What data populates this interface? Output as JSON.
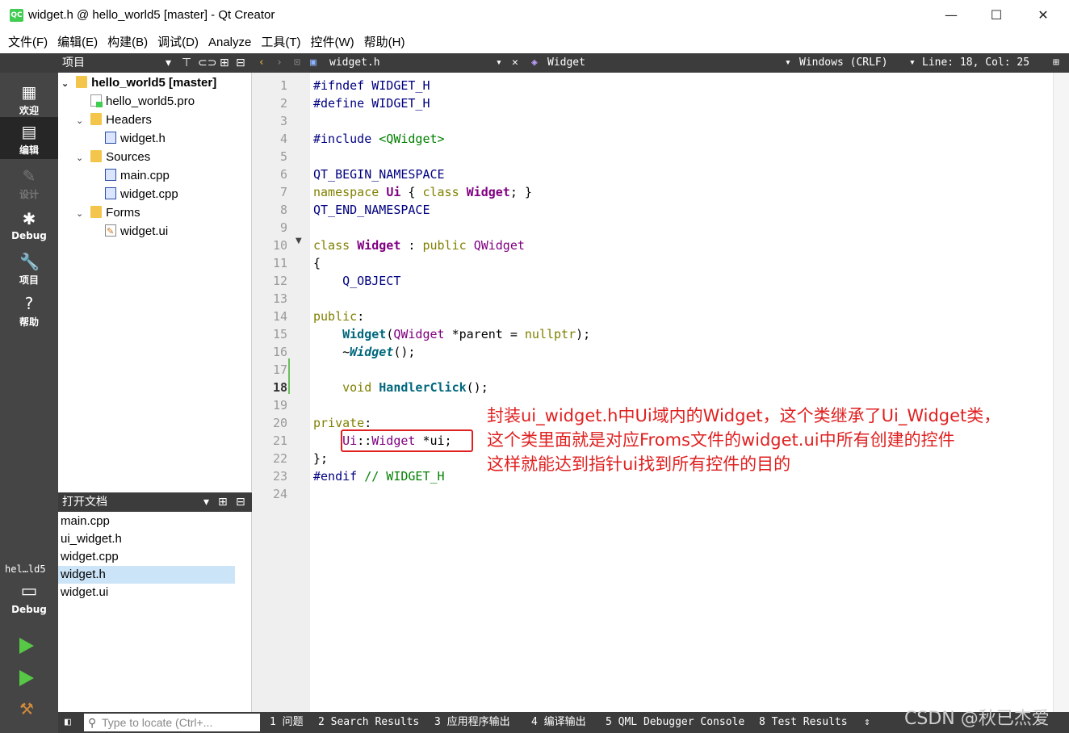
{
  "window": {
    "title": "widget.h @ hello_world5 [master] - Qt Creator",
    "app_icon_text": "QC",
    "controls": [
      "—",
      "☐",
      "✕"
    ]
  },
  "menu": [
    "文件(F)",
    "编辑(E)",
    "构建(B)",
    "调试(D)",
    "Analyze",
    "工具(T)",
    "控件(W)",
    "帮助(H)"
  ],
  "modes": [
    {
      "label": "欢迎",
      "icon": "grid-icon"
    },
    {
      "label": "编辑",
      "icon": "document-icon"
    },
    {
      "label": "设计",
      "icon": "pencil-icon"
    },
    {
      "label": "Debug",
      "icon": "bug-icon"
    },
    {
      "label": "项目",
      "icon": "wrench-icon"
    },
    {
      "label": "帮助",
      "icon": "help-icon"
    }
  ],
  "target": {
    "name": "hel…ld5",
    "label": "Debug"
  },
  "project_pane": {
    "title": "项目",
    "tree": [
      {
        "label": "hello_world5 [master]",
        "bold": true
      },
      {
        "label": "hello_world5.pro"
      },
      {
        "label": "Headers"
      },
      {
        "label": "widget.h"
      },
      {
        "label": "Sources"
      },
      {
        "label": "main.cpp"
      },
      {
        "label": "widget.cpp"
      },
      {
        "label": "Forms"
      },
      {
        "label": "widget.ui"
      }
    ]
  },
  "open_docs": {
    "title": "打开文档",
    "items": [
      "main.cpp",
      "ui_widget.h",
      "widget.cpp",
      "widget.h",
      "widget.ui"
    ],
    "selected": "widget.h"
  },
  "editor_toolbar": {
    "file": "widget.h",
    "symbol": "Widget",
    "line_ending": "Windows (CRLF)",
    "cursor": "Line: 18, Col: 25"
  },
  "editor": {
    "line_numbers": [
      "1",
      "2",
      "3",
      "4",
      "5",
      "6",
      "7",
      "8",
      "9",
      "10",
      "11",
      "12",
      "13",
      "14",
      "15",
      "16",
      "17",
      "18",
      "19",
      "20",
      "21",
      "22",
      "23",
      "24"
    ],
    "current_line": "18",
    "fold_marker_line": "10",
    "lines": [
      [
        {
          "t": "#ifndef WIDGET_H",
          "c": "mac"
        }
      ],
      [
        {
          "t": "#define WIDGET_H",
          "c": "mac"
        }
      ],
      [],
      [
        {
          "t": "#include ",
          "c": "mac"
        },
        {
          "t": "<QWidget>",
          "c": "str"
        }
      ],
      [],
      [
        {
          "t": "QT_BEGIN_NAMESPACE",
          "c": "mac"
        }
      ],
      [
        {
          "t": "namespace ",
          "c": "kw"
        },
        {
          "t": "Ui",
          "c": "cls"
        },
        {
          "t": " { ",
          "c": ""
        },
        {
          "t": "class ",
          "c": "kw"
        },
        {
          "t": "Widget",
          "c": "cls"
        },
        {
          "t": "; }",
          "c": ""
        }
      ],
      [
        {
          "t": "QT_END_NAMESPACE",
          "c": "mac"
        }
      ],
      [],
      [
        {
          "t": "class ",
          "c": "kw"
        },
        {
          "t": "Widget",
          "c": "cls"
        },
        {
          "t": " : ",
          "c": ""
        },
        {
          "t": "public ",
          "c": "kw"
        },
        {
          "t": "QWidget",
          "c": "typ"
        }
      ],
      [
        {
          "t": "{",
          "c": ""
        }
      ],
      [
        {
          "t": "    Q_OBJECT",
          "c": "mac"
        }
      ],
      [],
      [
        {
          "t": "public",
          "c": "kw"
        },
        {
          "t": ":",
          "c": ""
        }
      ],
      [
        {
          "t": "    ",
          "c": ""
        },
        {
          "t": "Widget",
          "c": "fn"
        },
        {
          "t": "(",
          "c": ""
        },
        {
          "t": "QWidget",
          "c": "typ"
        },
        {
          "t": " *parent = ",
          "c": ""
        },
        {
          "t": "nullptr",
          "c": "kw"
        },
        {
          "t": ");",
          "c": ""
        }
      ],
      [
        {
          "t": "    ~",
          "c": ""
        },
        {
          "t": "Widget",
          "c": "fni"
        },
        {
          "t": "();",
          "c": ""
        }
      ],
      [],
      [
        {
          "t": "    ",
          "c": ""
        },
        {
          "t": "void ",
          "c": "kw"
        },
        {
          "t": "HandlerClick",
          "c": "fn"
        },
        {
          "t": "();",
          "c": ""
        }
      ],
      [],
      [
        {
          "t": "private",
          "c": "kw"
        },
        {
          "t": ":",
          "c": ""
        }
      ],
      [
        {
          "t": "    ",
          "c": ""
        },
        {
          "t": "Ui",
          "c": "typ"
        },
        {
          "t": "::",
          "c": ""
        },
        {
          "t": "Widget",
          "c": "typ"
        },
        {
          "t": " *ui;",
          "c": ""
        }
      ],
      [
        {
          "t": "};",
          "c": ""
        }
      ],
      [
        {
          "t": "#endif ",
          "c": "mac"
        },
        {
          "t": "// WIDGET_H",
          "c": "cmt"
        }
      ],
      []
    ]
  },
  "annotation": {
    "lines": [
      "封装ui_widget.h中Ui域内的Widget，这个类继承了Ui_Widget类，",
      "这个类里面就是对应Froms文件的widget.ui中所有创建的控件",
      "这样就能达到指针ui找到所有控件的目的"
    ],
    "color": "#e02020"
  },
  "statusbar": {
    "locate_placeholder": "Type to locate (Ctrl+...",
    "tabs": [
      "1 问题",
      "2 Search Results",
      "3 应用程序输出",
      "4 编译输出",
      "5 QML Debugger Console",
      "8 Test Results"
    ]
  },
  "watermark": "CSDN @秋已杰爱"
}
